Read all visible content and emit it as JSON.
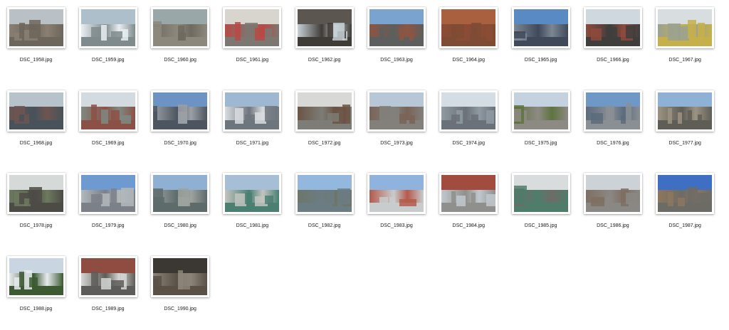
{
  "files": [
    {
      "name": "DSC_1958.jpg",
      "palette": [
        "#b9c1c7",
        "#8a7f72",
        "#6d665c"
      ]
    },
    {
      "name": "DSC_1959.jpg",
      "palette": [
        "#aebfcc",
        "#e9eef2",
        "#7f8b8c"
      ]
    },
    {
      "name": "DSC_1960.jpg",
      "palette": [
        "#9aa7a8",
        "#6e6a5f",
        "#8d887c"
      ]
    },
    {
      "name": "DSC_1961.jpg",
      "palette": [
        "#d8d5cf",
        "#b74a45",
        "#7c7770"
      ]
    },
    {
      "name": "DSC_1962.jpg",
      "palette": [
        "#5b5750",
        "#c7d0d6",
        "#3f3b36"
      ]
    },
    {
      "name": "DSC_1963.jpg",
      "palette": [
        "#7ba3cf",
        "#8e5541",
        "#5c5f5d"
      ]
    },
    {
      "name": "DSC_1964.jpg",
      "palette": [
        "#a9603f",
        "#8c4c34",
        "#7f4b35"
      ]
    },
    {
      "name": "DSC_1965.jpg",
      "palette": [
        "#5a8ac4",
        "#7a8893",
        "#40495a"
      ]
    },
    {
      "name": "DSC_1966.jpg",
      "palette": [
        "#cfd7df",
        "#8e4a3c",
        "#3f3e3d"
      ]
    },
    {
      "name": "DSC_1967.jpg",
      "palette": [
        "#d8dde0",
        "#9aa193",
        "#c5b04a"
      ]
    },
    {
      "name": "DSC_1968.jpg",
      "palette": [
        "#b7c3cb",
        "#6e5550",
        "#48525a"
      ]
    },
    {
      "name": "DSC_1969.jpg",
      "palette": [
        "#d3dbe1",
        "#7e8a82",
        "#8c5146"
      ]
    },
    {
      "name": "DSC_1970.jpg",
      "palette": [
        "#6d93c4",
        "#9aa0a5",
        "#4d5560"
      ]
    },
    {
      "name": "DSC_1971.jpg",
      "palette": [
        "#9fb8d2",
        "#d9dcdf",
        "#6e767d"
      ]
    },
    {
      "name": "DSC_1972.jpg",
      "palette": [
        "#d8d9d6",
        "#6b5444",
        "#7d7c76"
      ]
    },
    {
      "name": "DSC_1973.jpg",
      "palette": [
        "#b8c7d6",
        "#7a6357",
        "#83807b"
      ]
    },
    {
      "name": "DSC_1974.jpg",
      "palette": [
        "#d5dde4",
        "#8f9aa3",
        "#6b7178"
      ]
    },
    {
      "name": "DSC_1975.jpg",
      "palette": [
        "#c4d2df",
        "#5f7340",
        "#8d8a83"
      ]
    },
    {
      "name": "DSC_1976.jpg",
      "palette": [
        "#7098c7",
        "#5c6b7d",
        "#8a8f94"
      ]
    },
    {
      "name": "DSC_1977.jpg",
      "palette": [
        "#8fb1d6",
        "#9c9382",
        "#5f5e56"
      ]
    },
    {
      "name": "DSC_1978.jpg",
      "palette": [
        "#d5d9d8",
        "#6c7a5e",
        "#4d4b46"
      ]
    },
    {
      "name": "DSC_1979.jpg",
      "palette": [
        "#6e9ad0",
        "#b3b8bb",
        "#7b8089"
      ]
    },
    {
      "name": "DSC_1980.jpg",
      "palette": [
        "#8fb0d3",
        "#9ea39f",
        "#5e6b6b"
      ]
    },
    {
      "name": "DSC_1981.jpg",
      "palette": [
        "#a6bed6",
        "#c2c4bf",
        "#4a7f72"
      ]
    },
    {
      "name": "DSC_1982.jpg",
      "palette": [
        "#94b7de",
        "#6f7669",
        "#6b7c83"
      ]
    },
    {
      "name": "DSC_1983.jpg",
      "palette": [
        "#8fb3dc",
        "#b45a4c",
        "#c8cccc"
      ]
    },
    {
      "name": "DSC_1984.jpg",
      "palette": [
        "#a24c40",
        "#c1c8ce",
        "#8f8f8d"
      ]
    },
    {
      "name": "DSC_1985.jpg",
      "palette": [
        "#d9dcdc",
        "#6d6c66",
        "#4f7d6b"
      ]
    },
    {
      "name": "DSC_1986.jpg",
      "palette": [
        "#cdd2d6",
        "#7f6f61",
        "#8a8884"
      ]
    },
    {
      "name": "DSC_1987.jpg",
      "palette": [
        "#3e6fc2",
        "#8d775e",
        "#6d6b66"
      ]
    },
    {
      "name": "DSC_1988.jpg",
      "palette": [
        "#c9d6e2",
        "#e8ebee",
        "#3d5a33"
      ]
    },
    {
      "name": "DSC_1989.jpg",
      "palette": [
        "#8e4d40",
        "#d4d6d5",
        "#5e5c58"
      ]
    },
    {
      "name": "DSC_1990.jpg",
      "palette": [
        "#3b3733",
        "#8c8478",
        "#5a5046"
      ]
    }
  ]
}
